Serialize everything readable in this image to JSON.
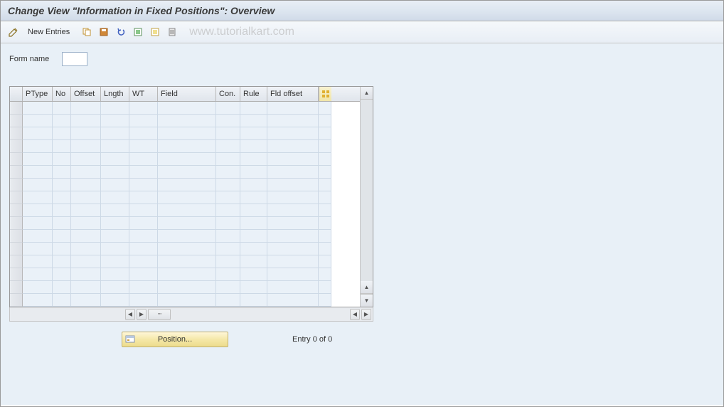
{
  "title": "Change View \"Information in Fixed Positions\": Overview",
  "toolbar": {
    "new_entries_label": "New Entries"
  },
  "watermark": "www.tutorialkart.com",
  "form": {
    "label_form_name": "Form name",
    "value_form_name": ""
  },
  "table": {
    "columns": [
      "PType",
      "No",
      "Offset",
      "Lngth",
      "WT",
      "Field",
      "Con.",
      "Rule",
      "Fld offset"
    ],
    "empty_rows": 16
  },
  "footer": {
    "position_label": "Position...",
    "entry_status": "Entry 0 of 0"
  },
  "colors": {
    "header_gradient_top": "#e8eef5",
    "content_bg": "#e8f0f7",
    "accent_button": "#f5e8a8"
  }
}
